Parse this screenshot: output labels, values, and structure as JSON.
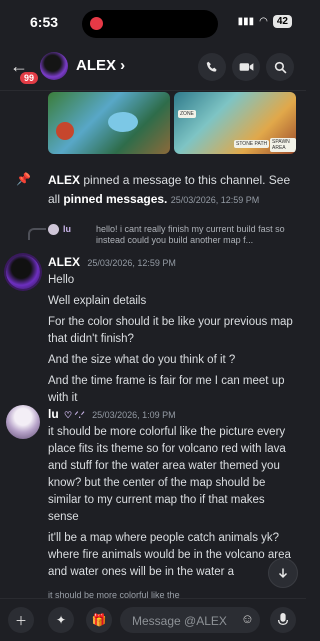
{
  "status": {
    "time": "6:53",
    "battery": "42"
  },
  "header": {
    "title": "ALEX ›",
    "unread_badge": "99"
  },
  "images": {
    "img2_tag_a": "ZONE",
    "img2_tag_b": "STONE PATH",
    "img2_tag_c": "SPAWN AREA"
  },
  "pinned": {
    "author": "ALEX",
    "text_before": " pinned a message to this channel. See all ",
    "link": "pinned messages.",
    "timestamp": "25/03/2026, 12:59 PM"
  },
  "reply_preview": {
    "name": "lu",
    "text": "hello! i cant really finish my current build fast so instead could you build another map f..."
  },
  "messages": [
    {
      "author": "ALEX",
      "timestamp": "25/03/2026, 12:59 PM",
      "lines": [
        "Hello",
        "Well explain details",
        "For the color should it be like your previous map that didn't finish?",
        "And the size what do you think of it ?",
        "And the time frame is fair for me  I can meet up with it"
      ]
    },
    {
      "author": "lu",
      "timestamp": "25/03/2026, 1:09 PM",
      "lines": [
        "it should be more colorful like the picture every place fits its theme so for volcano red with lava and stuff for the water area water themed you know? but the center of the map should be similar to my current map tho if that makes sense",
        "it'll be a map where people catch animals yk? where fire animals would be in the volcano area and water ones will be in the water a"
      ]
    }
  ],
  "next_preview": "it should be more colorful like the",
  "input": {
    "placeholder": "Message @ALEX"
  }
}
